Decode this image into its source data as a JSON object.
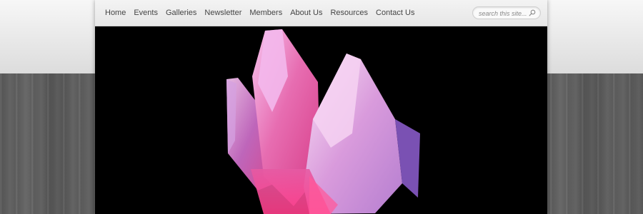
{
  "nav": {
    "items": [
      {
        "label": "Home"
      },
      {
        "label": "Events"
      },
      {
        "label": "Galleries"
      },
      {
        "label": "Newsletter"
      },
      {
        "label": "Members"
      },
      {
        "label": "About Us"
      },
      {
        "label": "Resources"
      },
      {
        "label": "Contact Us"
      }
    ]
  },
  "search": {
    "placeholder": "search this site...",
    "icon": "search-icon"
  },
  "hero": {
    "subject": "pink-crystal-cluster-photo",
    "colors": {
      "background": "#000000",
      "crystal_light": "#f5b6e6",
      "crystal_mid": "#e85aa5",
      "crystal_deep": "#d0307e"
    }
  },
  "colors": {
    "nav_text": "#444444",
    "nav_bg": "#ececec"
  }
}
